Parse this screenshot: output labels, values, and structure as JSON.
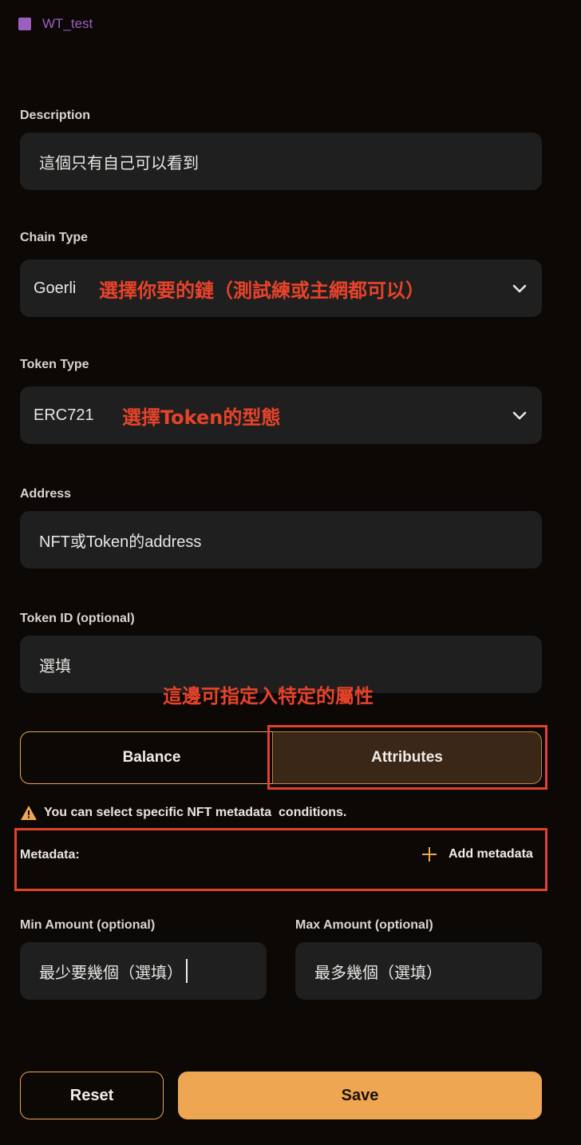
{
  "header": {
    "title": "WT_test",
    "icon_color": "#9b5fc0"
  },
  "description": {
    "label": "Description",
    "value": "這個只有自己可以看到"
  },
  "chain": {
    "label": "Chain Type",
    "value": "Goerli",
    "annotation": "選擇你要的鏈（測試練或主網都可以）"
  },
  "token_type": {
    "label": "Token Type",
    "value": "ERC721",
    "annotation": "選擇Token的型態"
  },
  "address": {
    "label": "Address",
    "value": "NFT或Token的address"
  },
  "token_id": {
    "label": "Token ID (optional)",
    "value": "選填",
    "annotation": "這邊可指定入特定的屬性"
  },
  "tabs": {
    "balance": "Balance",
    "attributes": "Attributes",
    "active": "attributes"
  },
  "warning": {
    "text": "You can select specific NFT metadata  conditions."
  },
  "metadata": {
    "label": "Metadata:",
    "add_label": "Add metadata"
  },
  "min_amount": {
    "label": "Min Amount (optional)",
    "value": "最少要幾個（選填）"
  },
  "max_amount": {
    "label": "Max Amount (optional)",
    "value": "最多幾個（選填）"
  },
  "actions": {
    "reset": "Reset",
    "save": "Save"
  },
  "colors": {
    "accent": "#efa652",
    "annotation": "#e0422a",
    "background": "#0b0806",
    "field": "#1f1f1f"
  }
}
